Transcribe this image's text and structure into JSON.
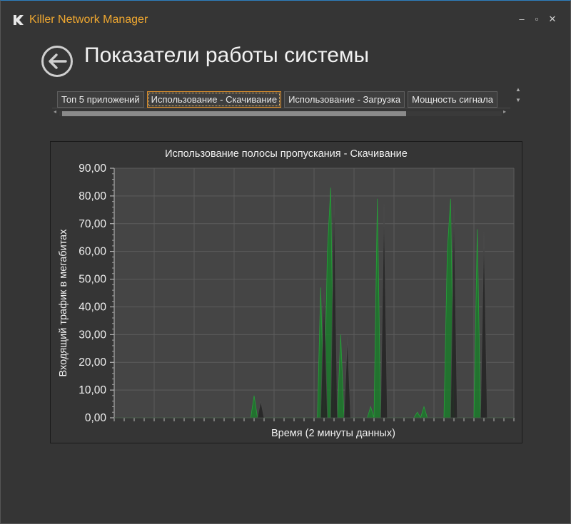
{
  "window": {
    "title": "Killer Network Manager",
    "controls": {
      "minimize": "–",
      "maximize": "▫",
      "close": "✕"
    }
  },
  "page": {
    "title": "Показатели работы системы"
  },
  "tabs": [
    {
      "label": "Топ 5 приложений",
      "active": false
    },
    {
      "label": "Использование - Скачивание",
      "active": true
    },
    {
      "label": "Использование - Загрузка",
      "active": false
    },
    {
      "label": "Мощность сигнала",
      "active": false
    }
  ],
  "colors": {
    "accent": "#f0a830",
    "plot_bg": "#454545",
    "series_green": "#1c7a2c",
    "series_dark": "#262626"
  },
  "chart_data": {
    "type": "area",
    "title": "Использование полосы пропускания - Скачивание",
    "xlabel": "Время (2 минуты данных)",
    "ylabel": "Входящий трафик в мегабитах",
    "ylim": [
      0,
      90
    ],
    "yticks": [
      "0,00",
      "10,00",
      "20,00",
      "30,00",
      "40,00",
      "50,00",
      "60,00",
      "70,00",
      "80,00",
      "90,00"
    ],
    "xlim": [
      0,
      120
    ],
    "grid": true,
    "series": [
      {
        "points": [
          [
            0,
            0
          ],
          [
            41,
            0
          ],
          [
            42,
            8
          ],
          [
            43,
            0
          ],
          [
            61,
            0
          ],
          [
            62,
            47
          ],
          [
            63,
            0
          ],
          [
            64,
            60
          ],
          [
            65,
            83
          ],
          [
            66,
            0
          ],
          [
            67,
            0
          ],
          [
            68,
            30
          ],
          [
            69,
            0
          ],
          [
            76,
            0
          ],
          [
            77,
            4
          ],
          [
            78,
            0
          ],
          [
            79,
            79
          ],
          [
            80,
            0
          ],
          [
            90,
            0
          ],
          [
            91,
            2
          ],
          [
            92,
            0
          ],
          [
            93,
            4
          ],
          [
            94,
            0
          ],
          [
            99,
            0
          ],
          [
            100,
            60
          ],
          [
            101,
            79
          ],
          [
            102,
            0
          ],
          [
            108,
            0
          ],
          [
            109,
            68
          ],
          [
            110,
            0
          ],
          [
            120,
            0
          ]
        ]
      },
      {
        "points": [
          [
            0,
            0
          ],
          [
            43,
            0
          ],
          [
            44,
            6
          ],
          [
            45,
            0
          ],
          [
            62,
            0
          ],
          [
            63,
            46
          ],
          [
            64,
            0
          ],
          [
            65,
            0
          ],
          [
            66,
            81
          ],
          [
            67,
            0
          ],
          [
            69,
            0
          ],
          [
            70,
            29
          ],
          [
            71,
            0
          ],
          [
            80,
            0
          ],
          [
            81,
            77
          ],
          [
            82,
            0
          ],
          [
            101,
            0
          ],
          [
            102,
            77
          ],
          [
            103,
            0
          ],
          [
            110,
            0
          ],
          [
            111,
            67
          ],
          [
            112,
            0
          ],
          [
            120,
            0
          ]
        ]
      }
    ]
  }
}
